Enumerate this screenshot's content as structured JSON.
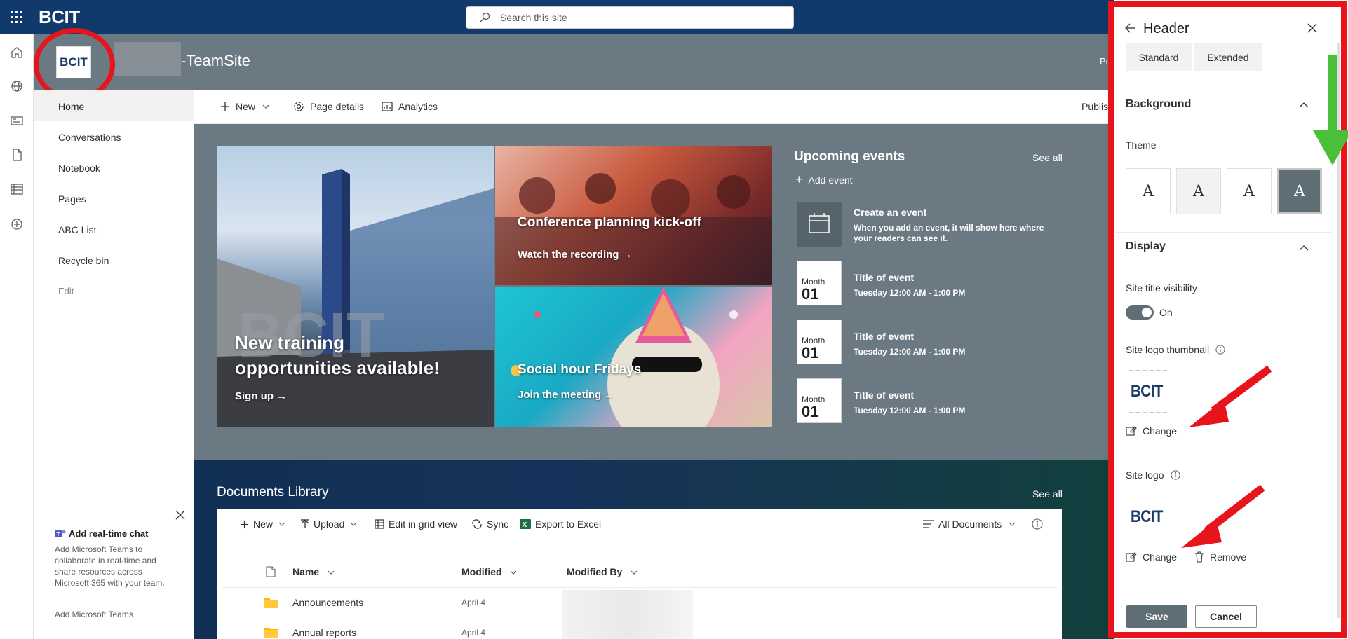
{
  "suitebar": {
    "brand": "BCIT",
    "search_placeholder": "Search this site"
  },
  "site": {
    "logo_text": "BCIT",
    "title": "-TeamSite",
    "publish_top": "Pu"
  },
  "nav": {
    "items": [
      {
        "label": "Home"
      },
      {
        "label": "Conversations"
      },
      {
        "label": "Notebook"
      },
      {
        "label": "Pages"
      },
      {
        "label": "ABC List"
      },
      {
        "label": "Recycle bin"
      },
      {
        "label": "Edit"
      }
    ]
  },
  "chat_promo": {
    "title": "Add real-time chat",
    "description": "Add Microsoft Teams to collaborate in real-time and share resources across Microsoft 365 with your team.",
    "link": "Add Microsoft Teams"
  },
  "commandbar": {
    "new_label": "New",
    "page_details_label": "Page details",
    "analytics_label": "Analytics",
    "publish_label": "Publis"
  },
  "hero": {
    "big": {
      "title_line1": "New training",
      "title_line2": "opportunities available!",
      "link": "Sign up"
    },
    "conf": {
      "title": "Conference planning kick-off",
      "link": "Watch the recording"
    },
    "social": {
      "title": "Social hour Fridays",
      "link": "Join the meeting"
    }
  },
  "events": {
    "title": "Upcoming events",
    "see_all": "See all",
    "add_event": "Add event",
    "create_title": "Create an event",
    "create_desc": "When you add an event, it will show here where your readers can see it.",
    "items": [
      {
        "month": "Month",
        "day": "01",
        "title": "Title of event",
        "time": "Tuesday 12:00 AM - 1:00 PM"
      },
      {
        "month": "Month",
        "day": "01",
        "title": "Title of event",
        "time": "Tuesday 12:00 AM - 1:00 PM"
      },
      {
        "month": "Month",
        "day": "01",
        "title": "Title of event",
        "time": "Tuesday 12:00 AM - 1:00 PM"
      }
    ]
  },
  "documents": {
    "title": "Documents Library",
    "see_all": "See all",
    "toolbar": {
      "new": "New",
      "upload": "Upload",
      "edit_grid": "Edit in grid view",
      "sync": "Sync",
      "export": "Export to Excel",
      "view": "All Documents"
    },
    "columns": {
      "name": "Name",
      "modified": "Modified",
      "modified_by": "Modified By"
    },
    "rows": [
      {
        "name": "Announcements",
        "modified": "April 4"
      },
      {
        "name": "Annual reports",
        "modified": "April 4"
      }
    ]
  },
  "pane": {
    "title": "Header",
    "layout_buttons": [
      "Standard",
      "Extended"
    ],
    "background_title": "Background",
    "theme_label": "Theme",
    "theme_glyph": "A",
    "display_title": "Display",
    "site_title_visibility": "Site title visibility",
    "toggle_state": "On",
    "site_logo_thumbnail": "Site logo thumbnail",
    "thumbnail_text": "BCIT",
    "change_label": "Change",
    "site_logo": "Site logo",
    "logo_text": "BCIT",
    "remove_label": "Remove",
    "save": "Save",
    "cancel": "Cancel"
  },
  "colors": {
    "suitebar": "#103a6b",
    "header_bg": "#6b7a82",
    "annotation_red": "#e8141c",
    "annotation_green": "#4cbf3a"
  }
}
